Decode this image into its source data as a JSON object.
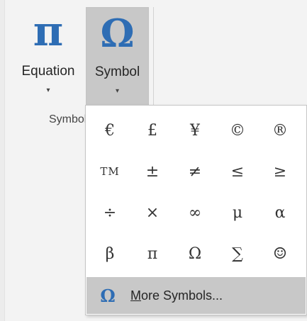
{
  "ribbon": {
    "equation": {
      "icon": "π",
      "label": "Equation",
      "caret": "▾"
    },
    "symbol": {
      "icon": "Ω",
      "label": "Symbol",
      "caret": "▾"
    },
    "group_label": "Symbols"
  },
  "symbol_gallery": {
    "symbols": [
      "€",
      "£",
      "¥",
      "©",
      "®",
      "TM",
      "±",
      "≠",
      "≤",
      "≥",
      "÷",
      "×",
      "∞",
      "μ",
      "α",
      "β",
      "π",
      "Ω",
      "∑",
      "☺"
    ],
    "more": {
      "icon": "Ω",
      "label_accel": "M",
      "label_rest": "ore Symbols..."
    }
  }
}
